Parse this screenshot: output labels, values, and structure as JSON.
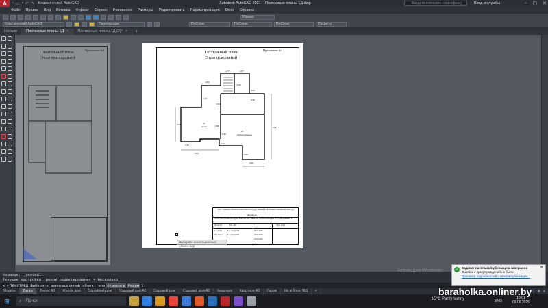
{
  "titlebar": {
    "app_title": "Autodesk AutoCAD 2021",
    "file_title": "Поэтажные планы 1Д.dwg",
    "workspace": "Классический AutoCAD",
    "search_placeholder": "Введите ключевое слово/фразу",
    "login": "Вход в службы"
  },
  "menu": [
    "Файл",
    "Правка",
    "Вид",
    "Вставка",
    "Формат",
    "Сервис",
    "Рисование",
    "Размеры",
    "Редактировать",
    "Параметризация",
    "Окно",
    "Справка"
  ],
  "toolbar": {
    "workspace_combo": "Классический AutoCAD",
    "layer_combo": "Перегородки",
    "dim_combo": "Размер",
    "color_combo": "ПоСлою",
    "linetype_combo": "ПоСлою",
    "lineweight_combo": "ПоСлою",
    "plotstyle_combo": "ПоЦвету"
  },
  "tabs": [
    {
      "label": "Начало",
      "active": false
    },
    {
      "label": "Поэтажные планы 1Д",
      "active": true
    },
    {
      "label": "Поэтажные планы 1Д (2)*",
      "active": false
    }
  ],
  "sheet_left": {
    "title_line1": "Поэтажный план",
    "title_line2": "Этаж мансардный",
    "appendix": "Приложение №1"
  },
  "sheet_main": {
    "title_line1": "Поэтажный план",
    "title_line2": "Этаж цокольный",
    "appendix": "Приложение №1",
    "org": "РУП \"Минское областное агентство по государственной регистрации и земельному кадастру\"",
    "object_type": "Жилой дом",
    "address": "223053 Республика Беларусь, Минская обл., Минский р-н, Боровлянский с/с, д. Дворищевка, 12",
    "scale_label": "Масштаб",
    "scale_value": "М 1:100",
    "sheet_label": "Лист 1 из 1",
    "roles": [
      "Составил",
      "Проверил"
    ],
    "names": [
      "Н.А. Трофимов",
      "Н.А. Трофимов"
    ],
    "dates": [
      "20.05.2025",
      "20.05.2025",
      "20.05.2025"
    ]
  },
  "plan_labels": {
    "room_main": "20",
    "room_main_name": "гараж",
    "room_right": "18",
    "room_right_name": "Жилая комната",
    "dims": [
      "4.80",
      "4.40",
      "0.30",
      "5.05",
      "2.77",
      "1.57",
      "3.00",
      "2.20",
      "3.98",
      "0.98",
      "3.04",
      "4.40",
      "2.40",
      "4.60",
      "2.30",
      "3.60",
      "11.21"
    ]
  },
  "annotation_tip": "Выберите аннотационный объект или",
  "command": {
    "history_line1": "Команда: _textedit",
    "history_line2": "Текущие настройки: режим редактирования = Несколько",
    "prompt": "ТЕКСТРЕД Выберите аннотационный объект или",
    "opt1": "Отменить",
    "opt2": "Режим"
  },
  "layout_tabs": [
    "Модель",
    "Белок",
    "Белок А3",
    "Жилой дом",
    "Сарайный дом",
    "Садовый дом А3",
    "Садовый дом",
    "Садовый дом А3",
    "Квартира",
    "Квартира А3",
    "Гараж",
    "Кв. в блок. ЖД",
    "+"
  ],
  "status": {
    "mode": "ЛИСТ",
    "scale": "1:1"
  },
  "notification": {
    "title": "Задание на печать/публикацию завершено",
    "body": "Ошибок и предупреждений не было",
    "link": "Просмотр подробностей о печати/публикации..."
  },
  "activation": "Активация Windows",
  "watermark": "baraholka.onliner.by",
  "taskbar": {
    "search": "Поиск",
    "weather": "15°C  Partly sunny",
    "lang": "ENG",
    "time": "10:01",
    "date": "09.06.2025"
  }
}
